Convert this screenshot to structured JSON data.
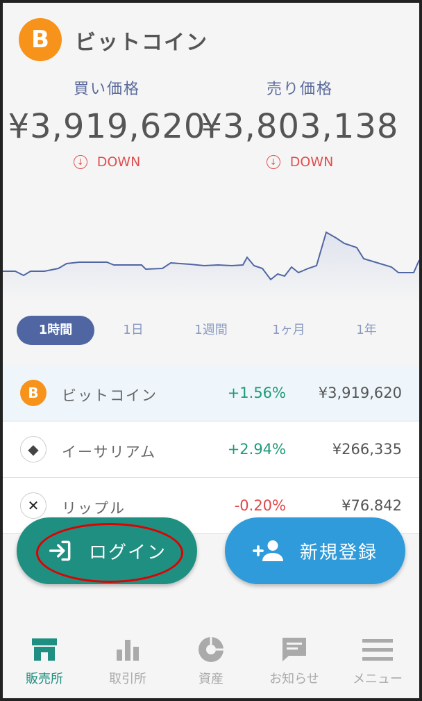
{
  "header": {
    "logo_symbol": "B",
    "title": "ビットコイン"
  },
  "prices": {
    "buy": {
      "label": "買い価格",
      "value": "¥3,919,620",
      "trend": "DOWN"
    },
    "sell": {
      "label": "売り価格",
      "value": "¥3,803,138",
      "trend": "DOWN"
    }
  },
  "period_tabs": [
    "1時間",
    "1日",
    "1週間",
    "1ヶ月",
    "1年"
  ],
  "coins": [
    {
      "name": "ビットコイン",
      "change": "+1.56%",
      "price": "¥3,919,620",
      "icon": "btc"
    },
    {
      "name": "イーサリアム",
      "change": "+2.94%",
      "price": "¥266,335",
      "icon": "eth"
    },
    {
      "name": "リップル",
      "change": "-0.20%",
      "price": "¥76.842",
      "icon": "xrp"
    }
  ],
  "buttons": {
    "login": "ログイン",
    "register": "新規登録"
  },
  "nav": [
    "販売所",
    "取引所",
    "資産",
    "お知らせ",
    "メニュー"
  ],
  "colors": {
    "accent_green": "#1e8f80",
    "accent_blue": "#2f9bdb",
    "down_red": "#e05050",
    "up_green": "#1d9a7a",
    "btc_orange": "#f7931a"
  }
}
